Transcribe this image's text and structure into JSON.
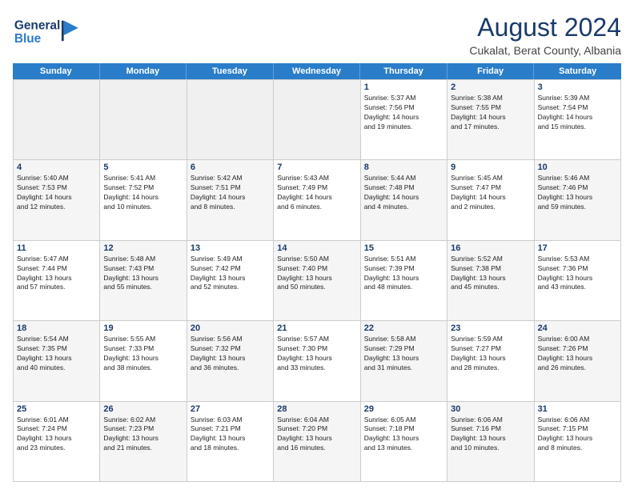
{
  "header": {
    "logo_line1": "General",
    "logo_line2": "Blue",
    "month_year": "August 2024",
    "location": "Cukalat, Berat County, Albania"
  },
  "weekdays": [
    "Sunday",
    "Monday",
    "Tuesday",
    "Wednesday",
    "Thursday",
    "Friday",
    "Saturday"
  ],
  "weeks": [
    [
      {
        "day": "",
        "empty": true
      },
      {
        "day": "",
        "empty": true
      },
      {
        "day": "",
        "empty": true
      },
      {
        "day": "",
        "empty": true
      },
      {
        "day": "1",
        "detail": "Sunrise: 5:37 AM\nSunset: 7:56 PM\nDaylight: 14 hours\nand 19 minutes."
      },
      {
        "day": "2",
        "detail": "Sunrise: 5:38 AM\nSunset: 7:55 PM\nDaylight: 14 hours\nand 17 minutes."
      },
      {
        "day": "3",
        "detail": "Sunrise: 5:39 AM\nSunset: 7:54 PM\nDaylight: 14 hours\nand 15 minutes."
      }
    ],
    [
      {
        "day": "4",
        "detail": "Sunrise: 5:40 AM\nSunset: 7:53 PM\nDaylight: 14 hours\nand 12 minutes."
      },
      {
        "day": "5",
        "detail": "Sunrise: 5:41 AM\nSunset: 7:52 PM\nDaylight: 14 hours\nand 10 minutes."
      },
      {
        "day": "6",
        "detail": "Sunrise: 5:42 AM\nSunset: 7:51 PM\nDaylight: 14 hours\nand 8 minutes."
      },
      {
        "day": "7",
        "detail": "Sunrise: 5:43 AM\nSunset: 7:49 PM\nDaylight: 14 hours\nand 6 minutes."
      },
      {
        "day": "8",
        "detail": "Sunrise: 5:44 AM\nSunset: 7:48 PM\nDaylight: 14 hours\nand 4 minutes."
      },
      {
        "day": "9",
        "detail": "Sunrise: 5:45 AM\nSunset: 7:47 PM\nDaylight: 14 hours\nand 2 minutes."
      },
      {
        "day": "10",
        "detail": "Sunrise: 5:46 AM\nSunset: 7:46 PM\nDaylight: 13 hours\nand 59 minutes."
      }
    ],
    [
      {
        "day": "11",
        "detail": "Sunrise: 5:47 AM\nSunset: 7:44 PM\nDaylight: 13 hours\nand 57 minutes."
      },
      {
        "day": "12",
        "detail": "Sunrise: 5:48 AM\nSunset: 7:43 PM\nDaylight: 13 hours\nand 55 minutes."
      },
      {
        "day": "13",
        "detail": "Sunrise: 5:49 AM\nSunset: 7:42 PM\nDaylight: 13 hours\nand 52 minutes."
      },
      {
        "day": "14",
        "detail": "Sunrise: 5:50 AM\nSunset: 7:40 PM\nDaylight: 13 hours\nand 50 minutes."
      },
      {
        "day": "15",
        "detail": "Sunrise: 5:51 AM\nSunset: 7:39 PM\nDaylight: 13 hours\nand 48 minutes."
      },
      {
        "day": "16",
        "detail": "Sunrise: 5:52 AM\nSunset: 7:38 PM\nDaylight: 13 hours\nand 45 minutes."
      },
      {
        "day": "17",
        "detail": "Sunrise: 5:53 AM\nSunset: 7:36 PM\nDaylight: 13 hours\nand 43 minutes."
      }
    ],
    [
      {
        "day": "18",
        "detail": "Sunrise: 5:54 AM\nSunset: 7:35 PM\nDaylight: 13 hours\nand 40 minutes."
      },
      {
        "day": "19",
        "detail": "Sunrise: 5:55 AM\nSunset: 7:33 PM\nDaylight: 13 hours\nand 38 minutes."
      },
      {
        "day": "20",
        "detail": "Sunrise: 5:56 AM\nSunset: 7:32 PM\nDaylight: 13 hours\nand 36 minutes."
      },
      {
        "day": "21",
        "detail": "Sunrise: 5:57 AM\nSunset: 7:30 PM\nDaylight: 13 hours\nand 33 minutes."
      },
      {
        "day": "22",
        "detail": "Sunrise: 5:58 AM\nSunset: 7:29 PM\nDaylight: 13 hours\nand 31 minutes."
      },
      {
        "day": "23",
        "detail": "Sunrise: 5:59 AM\nSunset: 7:27 PM\nDaylight: 13 hours\nand 28 minutes."
      },
      {
        "day": "24",
        "detail": "Sunrise: 6:00 AM\nSunset: 7:26 PM\nDaylight: 13 hours\nand 26 minutes."
      }
    ],
    [
      {
        "day": "25",
        "detail": "Sunrise: 6:01 AM\nSunset: 7:24 PM\nDaylight: 13 hours\nand 23 minutes."
      },
      {
        "day": "26",
        "detail": "Sunrise: 6:02 AM\nSunset: 7:23 PM\nDaylight: 13 hours\nand 21 minutes."
      },
      {
        "day": "27",
        "detail": "Sunrise: 6:03 AM\nSunset: 7:21 PM\nDaylight: 13 hours\nand 18 minutes."
      },
      {
        "day": "28",
        "detail": "Sunrise: 6:04 AM\nSunset: 7:20 PM\nDaylight: 13 hours\nand 16 minutes."
      },
      {
        "day": "29",
        "detail": "Sunrise: 6:05 AM\nSunset: 7:18 PM\nDaylight: 13 hours\nand 13 minutes."
      },
      {
        "day": "30",
        "detail": "Sunrise: 6:06 AM\nSunset: 7:16 PM\nDaylight: 13 hours\nand 10 minutes."
      },
      {
        "day": "31",
        "detail": "Sunrise: 6:06 AM\nSunset: 7:15 PM\nDaylight: 13 hours\nand 8 minutes."
      }
    ]
  ]
}
